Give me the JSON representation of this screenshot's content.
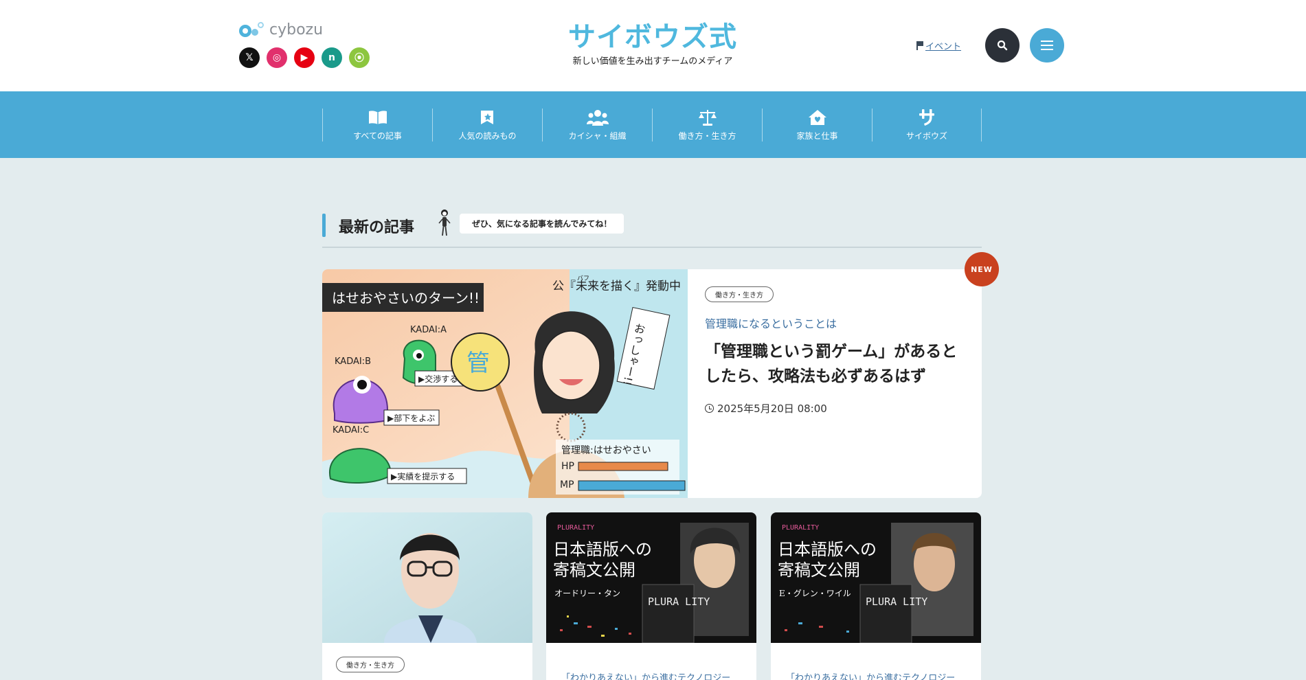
{
  "header": {
    "brand": "cybozu",
    "site_title": "サイボウズ式",
    "tagline": "新しい価値を生み出すチームのメディア",
    "event_link": "イベント",
    "social": [
      {
        "name": "x",
        "glyph": "𝕏"
      },
      {
        "name": "instagram",
        "glyph": "◎"
      },
      {
        "name": "youtube",
        "glyph": "▶"
      },
      {
        "name": "note",
        "glyph": "n"
      },
      {
        "name": "rss",
        "glyph": "⦿"
      }
    ]
  },
  "nav": {
    "items": [
      {
        "label": "すべての記事",
        "icon": "book-icon"
      },
      {
        "label": "人気の読みもの",
        "icon": "bookmark-star-icon"
      },
      {
        "label": "カイシャ・組織",
        "icon": "people-icon"
      },
      {
        "label": "働き方・生き方",
        "icon": "scale-icon"
      },
      {
        "label": "家族と仕事",
        "icon": "home-heart-icon"
      },
      {
        "label": "サイボウズ",
        "icon": "cybozu-sa-icon"
      }
    ]
  },
  "section": {
    "title": "最新の記事",
    "speech": "ぜひ、気になる記事を読んでみてね！"
  },
  "featured": {
    "badge": "NEW",
    "tag": "働き方・生き方",
    "subtitle": "管理職になるということは",
    "title": "「管理職という罰ゲーム」があるとしたら、攻略法も必ずあるはず",
    "date": "2025年5月20日 08:00",
    "image": {
      "banner": "はせおやさいのターン!!",
      "subtitle": "公『未来を描く』発動中",
      "kadai_a": "KADAI:A",
      "kadai_b": "KADAI:B",
      "kadai_c": "KADAI:C",
      "act_a": "▶交渉する",
      "act_b": "▶部下をよぶ",
      "act_c": "▶実績を提示する",
      "sign": "管",
      "shout": "おっしゃー!!",
      "role": "管理職:はせおやさい",
      "hp": "HP",
      "mp": "MP",
      "ruby": "バフ"
    }
  },
  "cards": [
    {
      "tag": "働き方・生き方",
      "subtitle": ""
    },
    {
      "tag": "",
      "subtitle": "「わかりあえない」から進むテクノロジー",
      "logo": "PLURALITY",
      "headline1": "日本語版への",
      "headline2": "寄稿文公開",
      "person": "オードリー・タン",
      "book": "PLURA LITY"
    },
    {
      "tag": "",
      "subtitle": "「わかりあえない」から進むテクノロジー",
      "logo": "PLURALITY",
      "headline1": "日本語版への",
      "headline2": "寄稿文公開",
      "person": "E・グレン・ワイル",
      "book": "PLURA LITY"
    }
  ],
  "colors": {
    "brand_blue": "#4aaad6",
    "background": "#e3ecee",
    "new_badge": "#c9411f",
    "link": "#3a6ea0"
  }
}
